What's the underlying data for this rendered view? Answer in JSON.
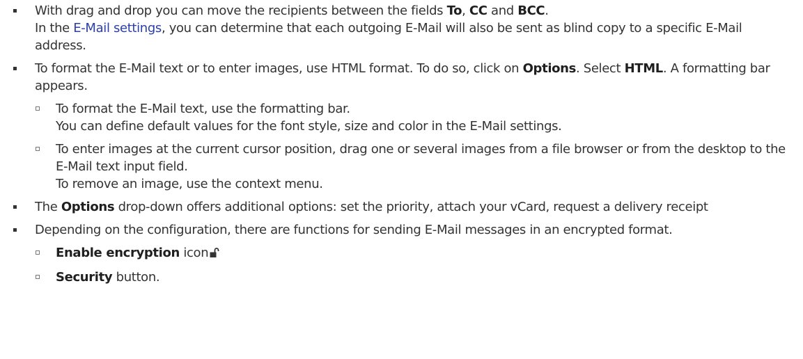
{
  "items": [
    {
      "p1": "With drag and drop you can move the recipients between the fields ",
      "b1": "To",
      "p2": ", ",
      "b2": "CC",
      "p3": " and ",
      "b3": "BCC",
      "p4": ".",
      "p5": "In the ",
      "link": "E-Mail settings",
      "p6": ", you can determine that each outgoing E-Mail will also be sent as blind copy to a specific E-Mail address."
    },
    {
      "p1": "To format the E-Mail text or to enter images, use HTML format. To do so, click on ",
      "b1": "Options",
      "p2": ". Select ",
      "b2": "HTML",
      "p3": ". A formatting bar appears.",
      "subitems": [
        {
          "line1": "To format the E-Mail text, use the formatting bar.",
          "line2": "You can define default values for the font style, size and color in the E-Mail settings."
        },
        {
          "line1": "To enter images at the current cursor position, drag one or several images from a file browser or from the desktop to the E-Mail text input field.",
          "line2": "To remove an image, use the context menu."
        }
      ]
    },
    {
      "b1": "Options",
      "p1": " drop-down offers additional options: set the priority, attach your vCard, request a delivery receipt",
      "p0": "The "
    },
    {
      "p1": "Depending on the configuration, there are functions for sending E-Mail messages in an encrypted format.",
      "subitems": [
        {
          "b1": "Enable encryption",
          "p1": " icon",
          "icon": "unlocked-padlock-icon"
        },
        {
          "b1": "Security",
          "p1": " button."
        }
      ]
    }
  ],
  "colors": {
    "text": "#333333",
    "link": "#2b3fa8",
    "bold": "#1f1f1f"
  }
}
